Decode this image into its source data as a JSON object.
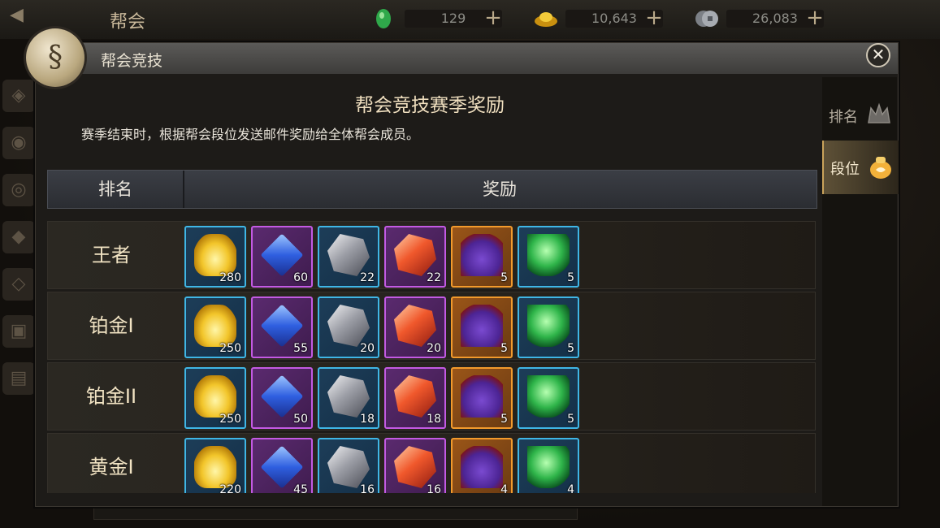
{
  "topbar": {
    "back_icon": "back-arrow-icon",
    "title": "帮会",
    "resources": [
      {
        "icon": "jade-icon",
        "color": "#2fa84a",
        "value": "129"
      },
      {
        "icon": "gold-ingot-icon",
        "color": "#e8b52a",
        "value": "10,643"
      },
      {
        "icon": "coin-icon",
        "color": "#9aa0a6",
        "value": "26,083"
      }
    ],
    "plus_label": "+"
  },
  "dialog": {
    "title": "帮会竞技",
    "emblem_glyph": "§",
    "close_label": "✕",
    "heading": "帮会竞技赛季奖励",
    "description": "赛季结束时，根据帮会段位发送邮件奖励给全体帮会成员。",
    "tabs": [
      {
        "label": "排名",
        "icon": "crown-icon",
        "selected": false
      },
      {
        "label": "段位",
        "icon": "pouch-icon",
        "selected": true
      }
    ],
    "table": {
      "headers": {
        "rank": "排名",
        "reward": "奖励"
      },
      "rows": [
        {
          "tier": "王者",
          "rewards": [
            "280",
            "60",
            "22",
            "22",
            "5",
            "5"
          ]
        },
        {
          "tier": "铂金I",
          "rewards": [
            "250",
            "55",
            "20",
            "20",
            "5",
            "5"
          ]
        },
        {
          "tier": "铂金II",
          "rewards": [
            "250",
            "50",
            "18",
            "18",
            "5",
            "5"
          ]
        },
        {
          "tier": "黄金I",
          "rewards": [
            "220",
            "45",
            "16",
            "16",
            "4",
            "4"
          ]
        }
      ],
      "reward_items": [
        {
          "name": "gold-ingot-item",
          "quality": "blue"
        },
        {
          "name": "sapphire-gem-item",
          "quality": "purple"
        },
        {
          "name": "silver-ore-item",
          "quality": "blue"
        },
        {
          "name": "ruby-ore-item",
          "quality": "purple"
        },
        {
          "name": "treasure-pouch-item",
          "quality": "orange"
        },
        {
          "name": "jade-orb-item",
          "quality": "blue"
        }
      ]
    }
  }
}
